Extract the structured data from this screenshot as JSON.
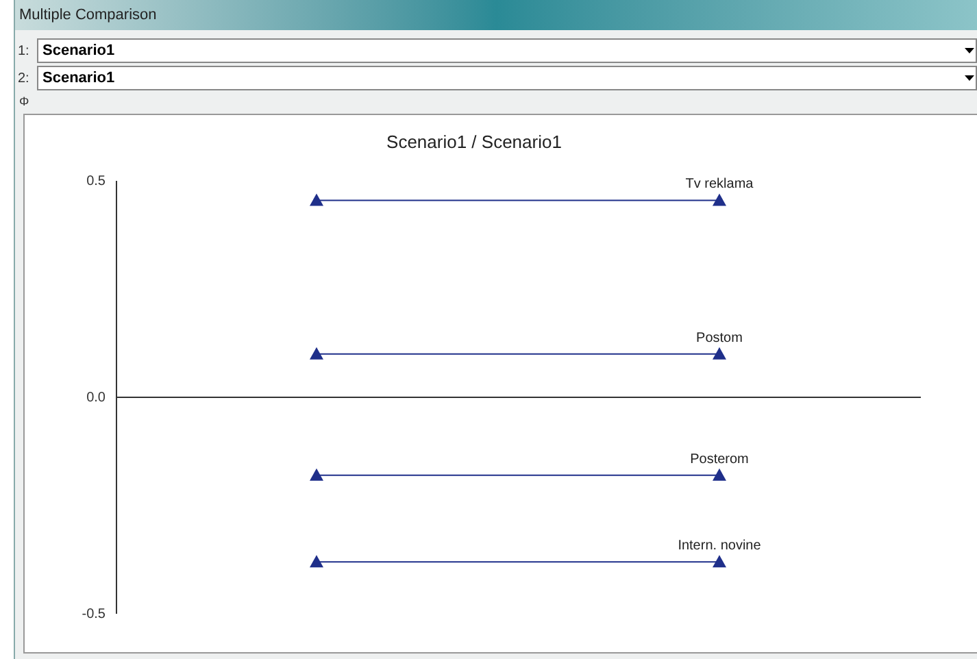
{
  "window": {
    "title": "Multiple Comparison"
  },
  "selectors": [
    {
      "label": "1:",
      "value": "Scenario1"
    },
    {
      "label": "2:",
      "value": "Scenario1"
    }
  ],
  "toolbar_glyph": "Φ",
  "chart": {
    "chart_data": {
      "type": "line",
      "title": "Scenario1 / Scenario1",
      "ylim": [
        -0.5,
        0.5
      ],
      "yticks": [
        {
          "value": 0.5,
          "label": "0.5"
        },
        {
          "value": 0,
          "label": "0.0"
        },
        {
          "value": -0.5,
          "label": "-0.5"
        }
      ],
      "series": [
        {
          "name": "Tv reklama",
          "color": "#1f2f8a",
          "marker": "triangle",
          "values": [
            0.455,
            0.455
          ]
        },
        {
          "name": "Postom",
          "color": "#1f2f8a",
          "marker": "triangle",
          "values": [
            0.1,
            0.1
          ]
        },
        {
          "name": "Posterom",
          "color": "#1f2f8a",
          "marker": "triangle",
          "values": [
            -0.18,
            -0.18
          ]
        },
        {
          "name": "Intern. novine",
          "color": "#1f2f8a",
          "marker": "triangle",
          "values": [
            -0.38,
            -0.38
          ]
        }
      ]
    }
  }
}
